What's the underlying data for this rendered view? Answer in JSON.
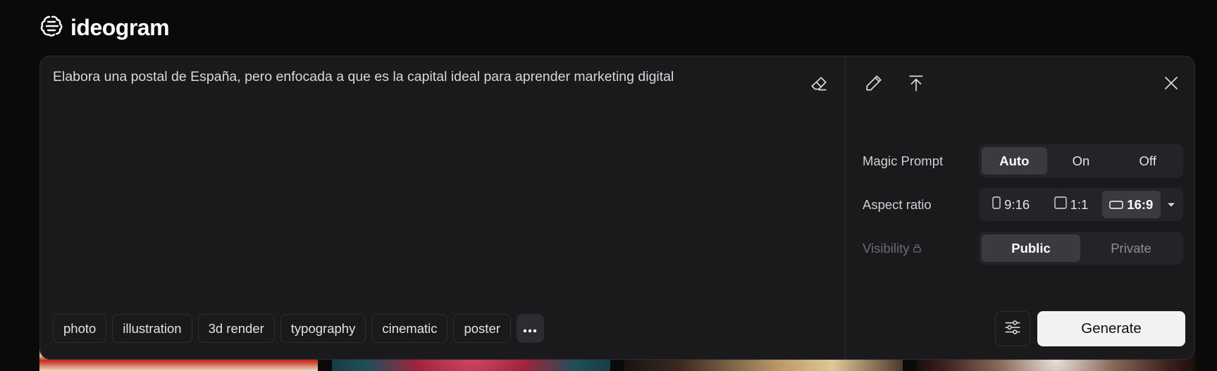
{
  "app": {
    "name": "ideogram"
  },
  "prompt": {
    "text": "Elabora una postal de España, pero enfocada a que es la capital ideal para aprender marketing digital"
  },
  "chips": [
    "photo",
    "illustration",
    "3d render",
    "typography",
    "cinematic",
    "poster"
  ],
  "settings": {
    "magic_prompt": {
      "label": "Magic Prompt",
      "options": [
        "Auto",
        "On",
        "Off"
      ],
      "selected": "Auto"
    },
    "aspect_ratio": {
      "label": "Aspect ratio",
      "options": [
        "9:16",
        "1:1",
        "16:9"
      ],
      "selected": "16:9"
    },
    "visibility": {
      "label": "Visibility",
      "options": [
        "Public",
        "Private"
      ],
      "selected": "Public"
    }
  },
  "actions": {
    "generate_label": "Generate"
  },
  "colors": {
    "background": "#0a0a0b",
    "panel": "#1a1a1d",
    "generate_button": "#f2f2f4"
  }
}
